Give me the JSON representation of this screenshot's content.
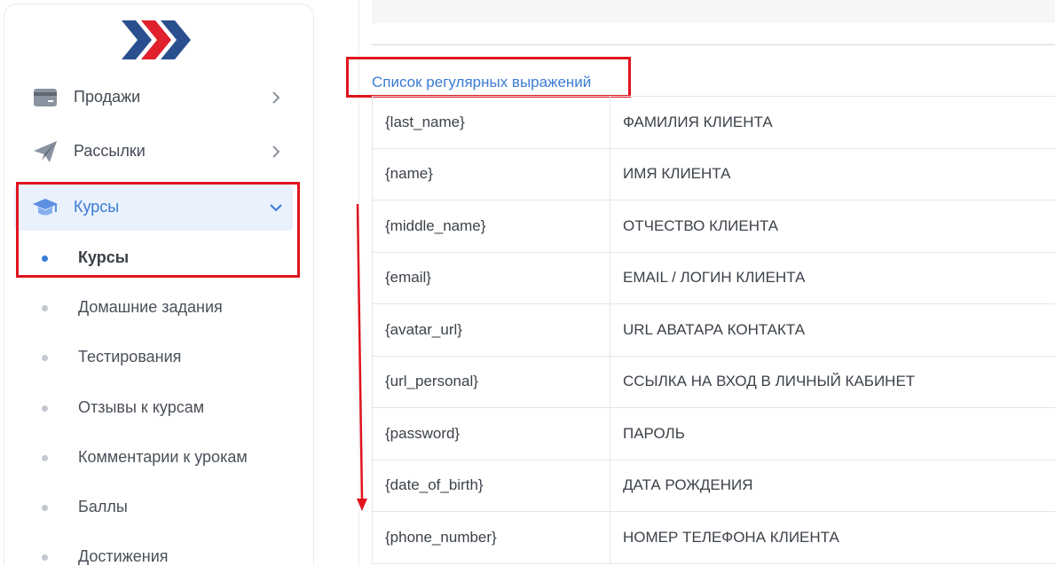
{
  "sidebar": {
    "logo_icon": "chevrons-logo",
    "items": [
      {
        "label": "Продажи",
        "icon": "card-icon",
        "expanded": false
      },
      {
        "label": "Рассылки",
        "icon": "paper-plane-icon",
        "expanded": false
      },
      {
        "label": "Курсы",
        "icon": "graduation-cap-icon",
        "expanded": true
      }
    ],
    "subitems": [
      {
        "label": "Курсы",
        "active": true
      },
      {
        "label": "Домашние задания",
        "active": false
      },
      {
        "label": "Тестирования",
        "active": false
      },
      {
        "label": "Отзывы к курсам",
        "active": false
      },
      {
        "label": "Комментарии к урокам",
        "active": false
      },
      {
        "label": "Баллы",
        "active": false
      },
      {
        "label": "Достижения",
        "active": false
      }
    ]
  },
  "main": {
    "section_title": "Список регулярных выражений",
    "rows": [
      {
        "key": "{last_name}",
        "value": "ФАМИЛИЯ КЛИЕНТА"
      },
      {
        "key": "{name}",
        "value": "ИМЯ КЛИЕНТА"
      },
      {
        "key": "{middle_name}",
        "value": "ОТЧЕСТВО КЛИЕНТА"
      },
      {
        "key": "{email}",
        "value": "EMAIL / ЛОГИН КЛИЕНТА"
      },
      {
        "key": "{avatar_url}",
        "value": "URL АВАТАРА КОНТАКТА"
      },
      {
        "key": "{url_personal}",
        "value": "ССЫЛКА НА ВХОД В ЛИЧНЫЙ КАБИНЕТ"
      },
      {
        "key": "{password}",
        "value": "ПАРОЛЬ"
      },
      {
        "key": "{date_of_birth}",
        "value": "ДАТА РОЖДЕНИЯ"
      },
      {
        "key": "{phone_number}",
        "value": "НОМЕР ТЕЛЕФОНА КЛИЕНТА"
      }
    ]
  },
  "colors": {
    "accent": "#3a7bd5",
    "highlight_box": "#e0141e",
    "active_bg": "#e9f1fd"
  }
}
